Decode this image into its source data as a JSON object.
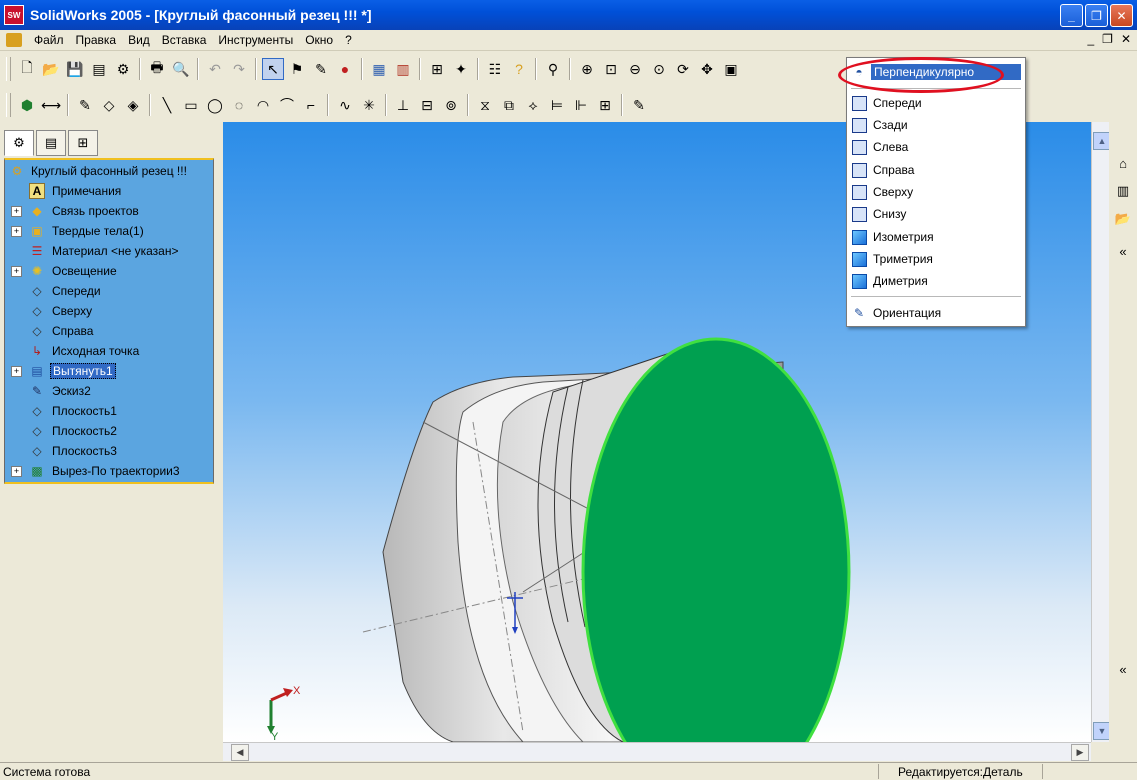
{
  "window": {
    "title": "SolidWorks 2005 - [Круглый фасонный резец !!! *]",
    "app_icon_text": "SW"
  },
  "menu": {
    "items": [
      "Файл",
      "Правка",
      "Вид",
      "Вставка",
      "Инструменты",
      "Окно",
      "?"
    ]
  },
  "tree": {
    "items": [
      {
        "label": "Круглый фасонный резец !!!",
        "icon": "part-icon",
        "expander": ""
      },
      {
        "label": "Примечания",
        "icon": "annotations-icon",
        "expander": ""
      },
      {
        "label": "Связь проектов",
        "icon": "design-binder-icon",
        "expander": "+"
      },
      {
        "label": "Твердые тела(1)",
        "icon": "solid-bodies-icon",
        "expander": "+"
      },
      {
        "label": "Материал <не указан>",
        "icon": "material-icon",
        "expander": ""
      },
      {
        "label": "Освещение",
        "icon": "lighting-icon",
        "expander": "+"
      },
      {
        "label": "Спереди",
        "icon": "plane-icon",
        "expander": ""
      },
      {
        "label": "Сверху",
        "icon": "plane-icon",
        "expander": ""
      },
      {
        "label": "Справа",
        "icon": "plane-icon",
        "expander": ""
      },
      {
        "label": "Исходная точка",
        "icon": "origin-icon",
        "expander": ""
      },
      {
        "label": "Вытянуть1",
        "icon": "extrude-icon",
        "expander": "+"
      },
      {
        "label": "Эскиз2",
        "icon": "sketch-icon",
        "expander": ""
      },
      {
        "label": "Плоскость1",
        "icon": "plane-icon",
        "expander": ""
      },
      {
        "label": "Плоскость2",
        "icon": "plane-icon",
        "expander": ""
      },
      {
        "label": "Плоскость3",
        "icon": "plane-icon",
        "expander": ""
      },
      {
        "label": "Вырез-По траектории3",
        "icon": "sweep-cut-icon",
        "expander": "+"
      }
    ],
    "selected_index": 10
  },
  "view_orientation_menu": {
    "items": [
      {
        "label": "Перпендикулярно",
        "icon": "normal-to-icon",
        "highlighted": true
      },
      {
        "label": "Спереди",
        "icon": "front-view-icon"
      },
      {
        "label": "Сзади",
        "icon": "back-view-icon"
      },
      {
        "label": "Слева",
        "icon": "left-view-icon"
      },
      {
        "label": "Справа",
        "icon": "right-view-icon"
      },
      {
        "label": "Сверху",
        "icon": "top-view-icon"
      },
      {
        "label": "Снизу",
        "icon": "bottom-view-icon"
      },
      {
        "label": "Изометрия",
        "icon": "isometric-view-icon"
      },
      {
        "label": "Триметрия",
        "icon": "trimetric-view-icon"
      },
      {
        "label": "Диметрия",
        "icon": "dimetric-view-icon"
      },
      {
        "label": "Ориентация",
        "icon": "orientation-icon"
      }
    ]
  },
  "triad": {
    "x_label": "X",
    "y_label": "Y"
  },
  "status": {
    "left": "Система готова",
    "right": "Редактируется:Деталь"
  },
  "colors": {
    "selected_face": "#00a050",
    "tree_bg": "#5ba5e0",
    "highlight": "#316ac5",
    "annotation_ellipse": "#e01020"
  }
}
